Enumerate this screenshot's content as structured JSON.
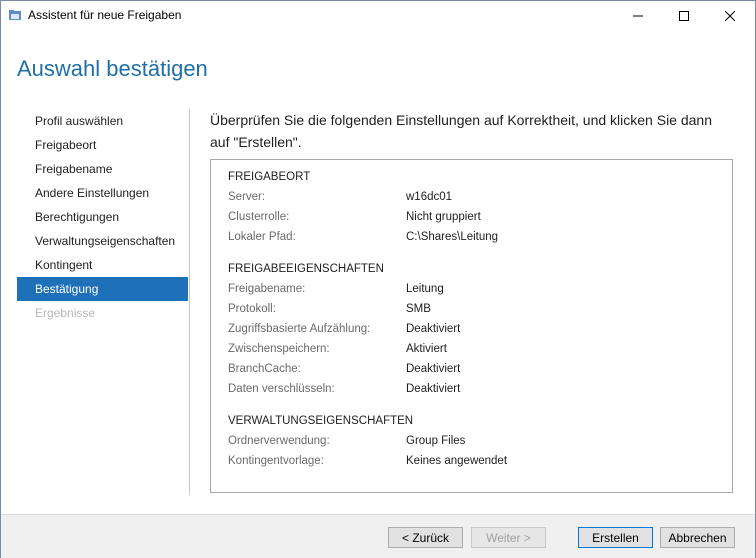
{
  "window": {
    "title": "Assistent für neue Freigaben",
    "icons": {
      "app": "share-folder-icon",
      "minimize": "minimize-icon",
      "maximize": "maximize-icon",
      "close": "close-icon"
    }
  },
  "page": {
    "title": "Auswahl bestätigen",
    "intro": "Überprüfen Sie die folgenden Einstellungen auf Korrektheit, und klicken Sie dann auf \"Erstellen\"."
  },
  "nav": {
    "items": [
      {
        "label": "Profil auswählen"
      },
      {
        "label": "Freigabeort"
      },
      {
        "label": "Freigabename"
      },
      {
        "label": "Andere Einstellungen"
      },
      {
        "label": "Berechtigungen"
      },
      {
        "label": "Verwaltungseigenschaften"
      },
      {
        "label": "Kontingent"
      },
      {
        "label": "Bestätigung"
      },
      {
        "label": "Ergebnisse"
      }
    ],
    "active_index": 7
  },
  "summary": {
    "sections": [
      {
        "title": "FREIGABEORT",
        "rows": [
          {
            "label": "Server:",
            "value": "w16dc01"
          },
          {
            "label": "Clusterrolle:",
            "value": "Nicht gruppiert"
          },
          {
            "label": "Lokaler Pfad:",
            "value": "C:\\Shares\\Leitung"
          }
        ]
      },
      {
        "title": "FREIGABEEIGENSCHAFTEN",
        "rows": [
          {
            "label": "Freigabename:",
            "value": "Leitung"
          },
          {
            "label": "Protokoll:",
            "value": "SMB"
          },
          {
            "label": "Zugriffsbasierte Aufzählung:",
            "value": "Deaktiviert"
          },
          {
            "label": "Zwischenspeichern:",
            "value": "Aktiviert"
          },
          {
            "label": "BranchCache:",
            "value": "Deaktiviert"
          },
          {
            "label": "Daten verschlüsseln:",
            "value": "Deaktiviert"
          }
        ]
      },
      {
        "title": "VERWALTUNGSEIGENSCHAFTEN",
        "rows": [
          {
            "label": "Ordnerverwendung:",
            "value": "Group Files"
          },
          {
            "label": "Kontingentvorlage:",
            "value": "Keines angewendet"
          }
        ]
      }
    ]
  },
  "footer": {
    "back_label": "< Zurück",
    "next_label": "Weiter >",
    "create_label": "Erstellen",
    "cancel_label": "Abbrechen"
  },
  "colors": {
    "accent": "#1e70b9",
    "title": "#1f6fa8"
  }
}
